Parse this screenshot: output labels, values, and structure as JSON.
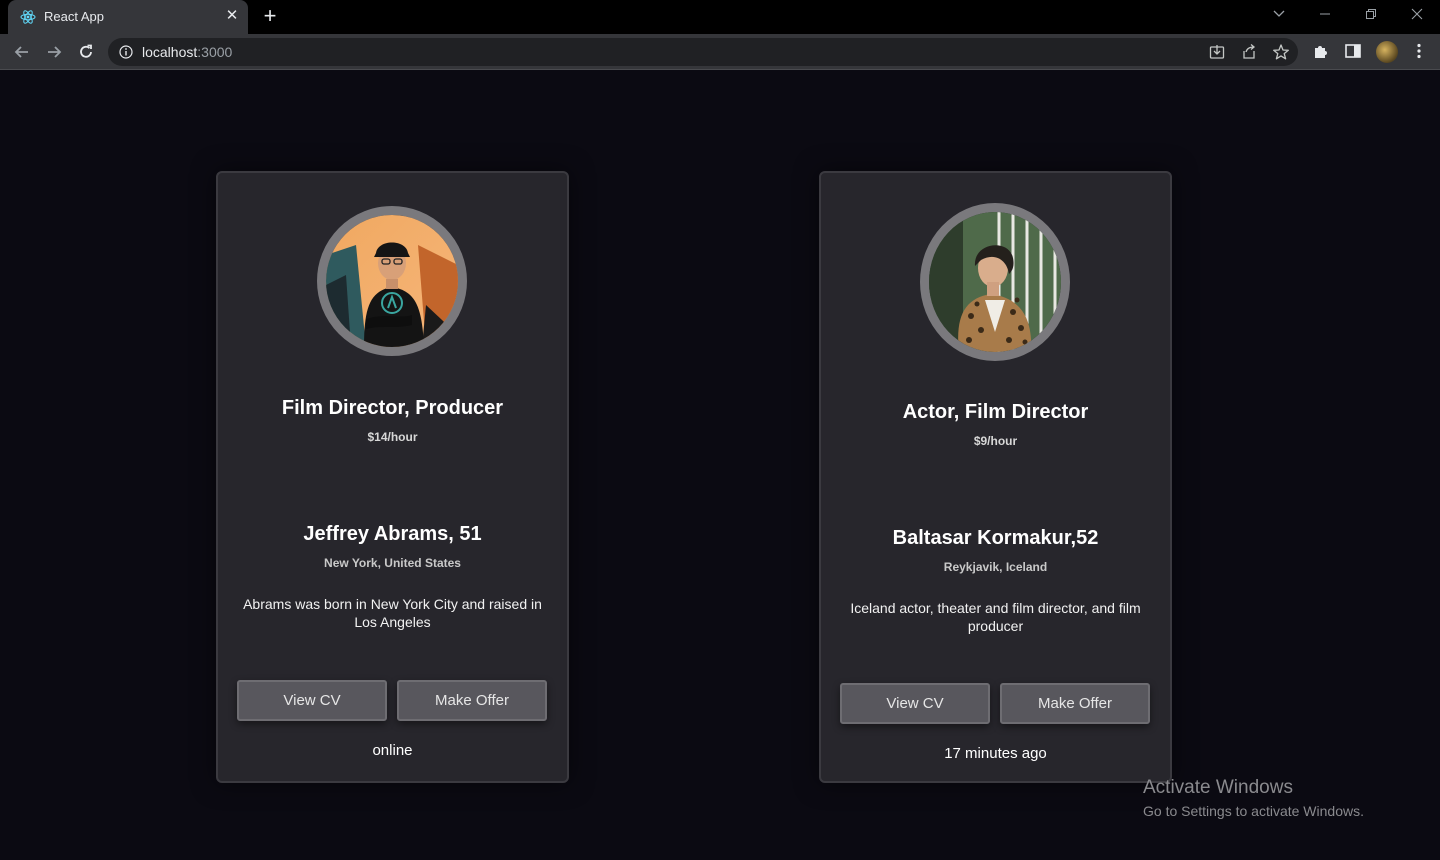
{
  "browser": {
    "tab_title": "React App",
    "url_host": "localhost",
    "url_port": ":3000"
  },
  "cards": [
    {
      "role": "Film Director, Producer",
      "rate": "$14/hour",
      "name": "Jeffrey Abrams, 51",
      "location": "New York, United States",
      "bio": "Abrams was born in New York City and raised in Los Angeles",
      "view_cv_label": "View CV",
      "make_offer_label": "Make Offer",
      "status": "online"
    },
    {
      "role": "Actor, Film Director",
      "rate": "$9/hour",
      "name": "Baltasar Kormakur,52",
      "location": "Reykjavik, Iceland",
      "bio": "Iceland actor, theater and film director, and film producer",
      "view_cv_label": "View CV",
      "make_offer_label": "Make Offer",
      "status": "17 minutes ago"
    }
  ],
  "watermark": {
    "line1": "Activate Windows",
    "line2": "Go to Settings to activate Windows."
  },
  "icons": {
    "tab_favicon": "react-icon",
    "nav": [
      "back-arrow-icon",
      "forward-arrow-icon",
      "reload-icon"
    ],
    "omnibox": [
      "info-icon",
      "install-app-icon",
      "share-icon",
      "bookmark-star-icon"
    ],
    "toolbar": [
      "extensions-puzzle-icon",
      "side-panel-icon",
      "profile-avatar",
      "menu-kebab-icon"
    ]
  },
  "colors": {
    "page_bg": "#0b0a12",
    "card_bg": "#27262c",
    "button_bg": "#58575d",
    "photo_ring": "#7a797d"
  }
}
